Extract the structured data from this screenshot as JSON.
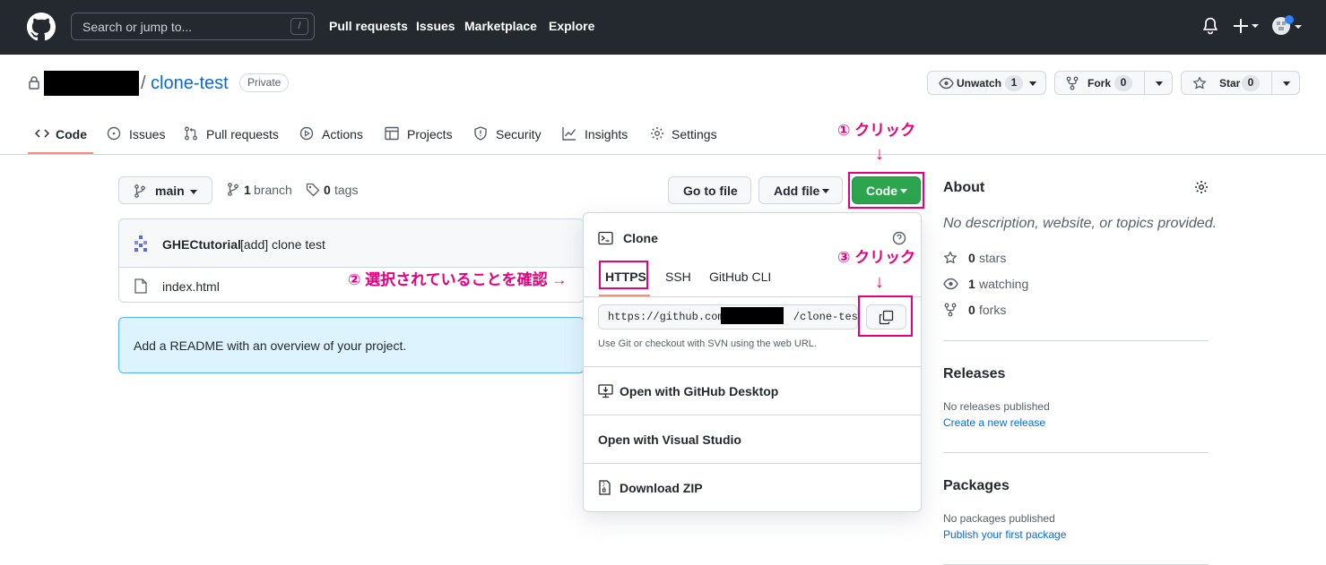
{
  "header": {
    "search_placeholder": "Search or jump to...",
    "search_shortcut": "/",
    "nav": [
      "Pull requests",
      "Issues",
      "Marketplace",
      "Explore"
    ]
  },
  "repo": {
    "name": "clone-test",
    "separator": "/",
    "visibility": "Private",
    "watch": {
      "label": "Unwatch",
      "count": "1"
    },
    "fork": {
      "label": "Fork",
      "count": "0"
    },
    "star": {
      "label": "Star",
      "count": "0"
    }
  },
  "tabs": [
    {
      "label": "Code",
      "icon": "code-icon"
    },
    {
      "label": "Issues",
      "icon": "issue-icon"
    },
    {
      "label": "Pull requests",
      "icon": "pull-request-icon"
    },
    {
      "label": "Actions",
      "icon": "play-icon"
    },
    {
      "label": "Projects",
      "icon": "table-icon"
    },
    {
      "label": "Security",
      "icon": "shield-icon"
    },
    {
      "label": "Insights",
      "icon": "graph-icon"
    },
    {
      "label": "Settings",
      "icon": "gear-icon"
    }
  ],
  "filebar": {
    "branch": "main",
    "branch_count": "1",
    "branch_word": "branch",
    "tag_count": "0",
    "tag_word": "tags",
    "goto_file": "Go to file",
    "add_file": "Add file",
    "code": "Code"
  },
  "files": {
    "commit_author": "GHECtutorial",
    "commit_message": "[add] clone test",
    "items": [
      "index.html"
    ],
    "readme_prompt": "Add a README with an overview of your project."
  },
  "clone": {
    "title": "Clone",
    "tabs": [
      "HTTPS",
      "SSH",
      "GitHub CLI"
    ],
    "url_prefix": "https://github.com/",
    "url_suffix": "/clone-test.g",
    "hint": "Use Git or checkout with SVN using the web URL.",
    "desktop": "Open with GitHub Desktop",
    "visual_studio": "Open with Visual Studio",
    "zip": "Download ZIP"
  },
  "about": {
    "title": "About",
    "description": "No description, website, or topics provided.",
    "stars": {
      "count": "0",
      "word": "stars"
    },
    "watching": {
      "count": "1",
      "word": "watching"
    },
    "forks": {
      "count": "0",
      "word": "forks"
    },
    "releases_title": "Releases",
    "releases_none": "No releases published",
    "releases_link": "Create a new release",
    "packages_title": "Packages",
    "packages_none": "No packages published",
    "packages_link": "Publish your first package"
  },
  "annotations": {
    "step1": "① クリック",
    "step2": "② 選択されていることを確認 →",
    "step3": "③ クリック",
    "arrow": "↓"
  },
  "colors": {
    "header_bg": "#24292f",
    "primary_green": "#2da44e",
    "link_blue": "#0969da",
    "annotation_pink": "#e4007f",
    "tab_underline": "#fd8c73"
  }
}
